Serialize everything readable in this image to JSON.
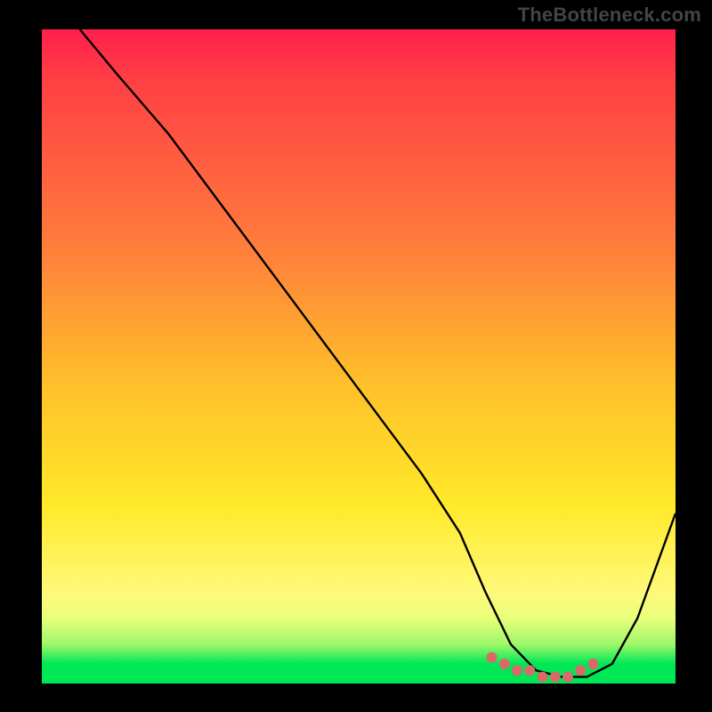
{
  "watermark": "TheBottleneck.com",
  "chart_data": {
    "type": "line",
    "title": "",
    "xlabel": "",
    "ylabel": "",
    "xlim": [
      0,
      100
    ],
    "ylim": [
      0,
      100
    ],
    "grid": false,
    "series": [
      {
        "name": "curve",
        "color": "#000000",
        "x": [
          6,
          12,
          20,
          30,
          40,
          50,
          60,
          66,
          70,
          74,
          78,
          82,
          86,
          90,
          94,
          100
        ],
        "values": [
          100,
          93,
          84,
          71,
          58,
          45,
          32,
          23,
          14,
          6,
          2,
          1,
          1,
          3,
          10,
          26
        ]
      }
    ],
    "markers": {
      "color": "#d86a6a",
      "radius": 6,
      "x": [
        71,
        73,
        75,
        77,
        79,
        81,
        83,
        85,
        87
      ],
      "values": [
        4,
        3,
        2,
        2,
        1,
        1,
        1,
        2,
        3
      ]
    },
    "gradient_background": {
      "top": "#ff1f4a",
      "mid1": "#ff7a3c",
      "mid2": "#ffe92a",
      "green": "#00e756"
    }
  }
}
